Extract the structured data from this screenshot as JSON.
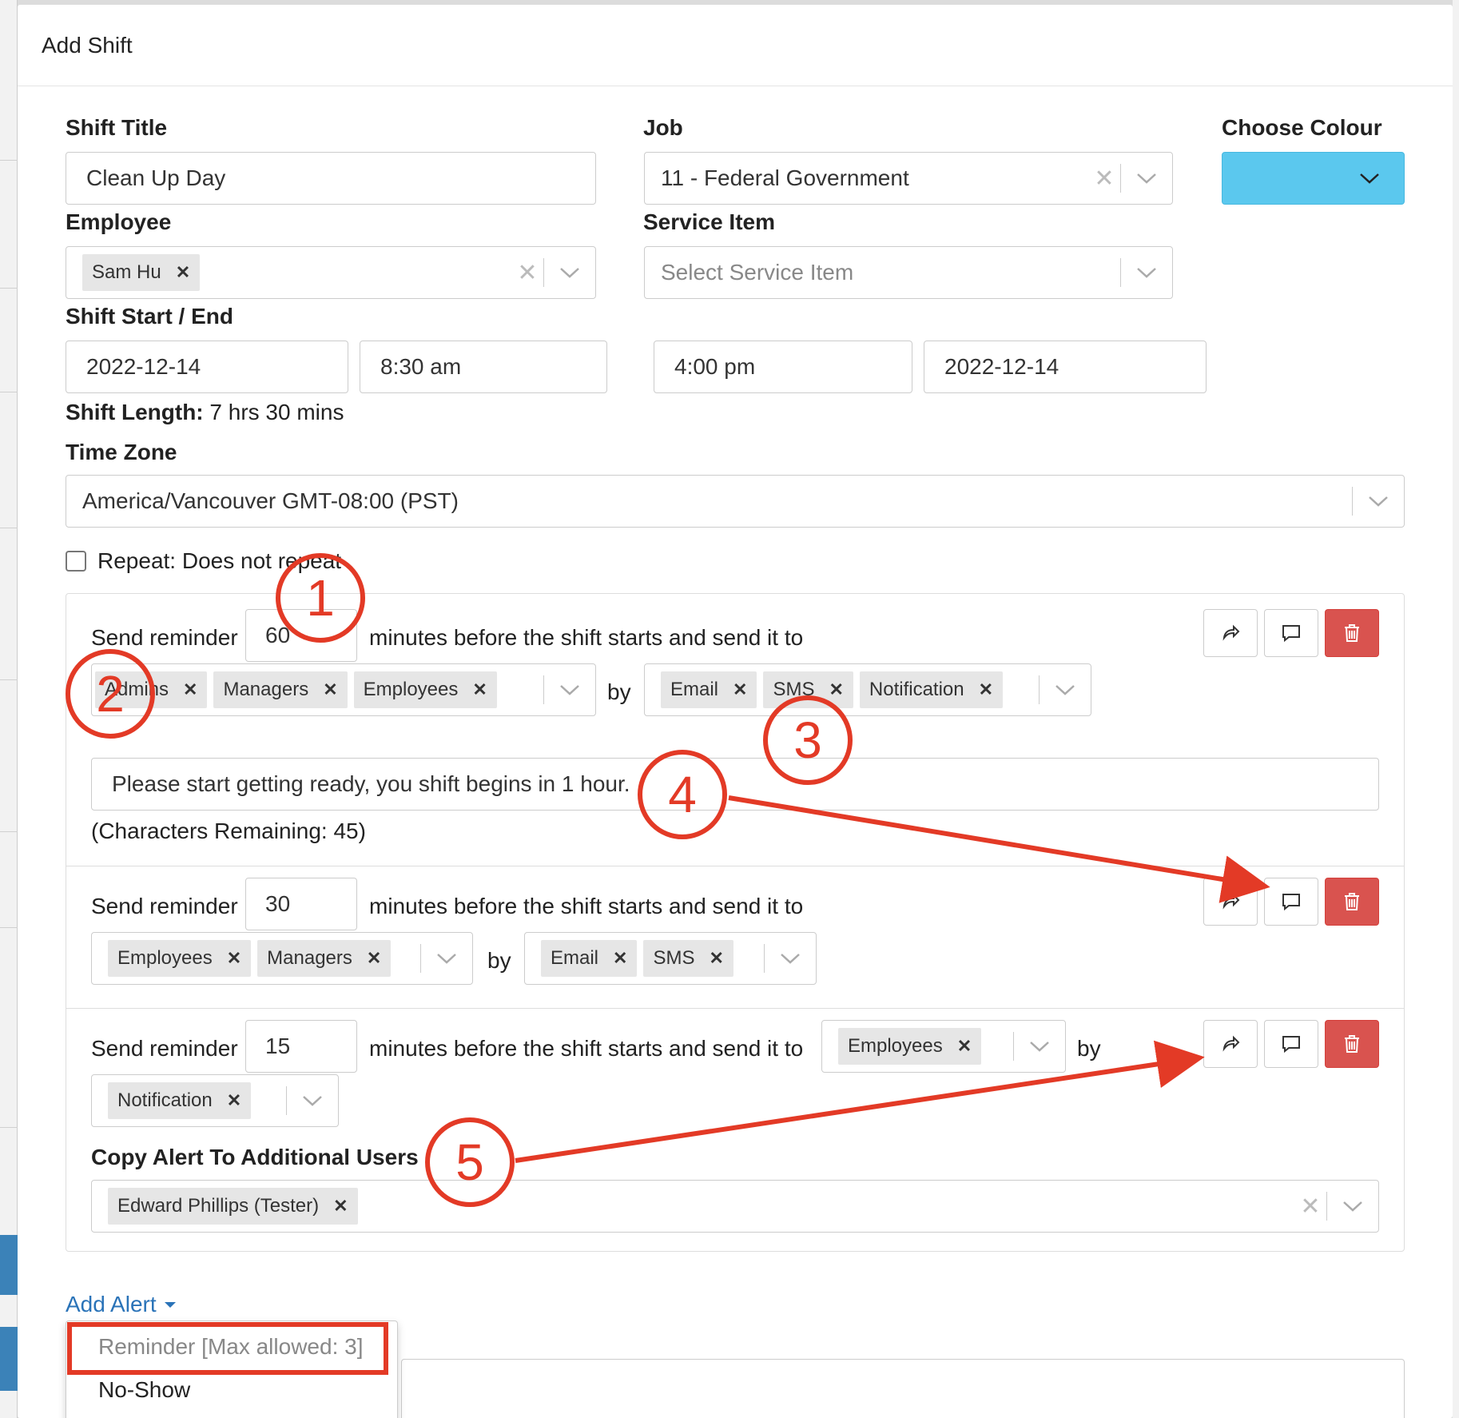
{
  "modal": {
    "title": "Add Shift"
  },
  "form": {
    "shift_title_label": "Shift Title",
    "shift_title_value": "Clean Up Day",
    "job_label": "Job",
    "job_value": "11 - Federal Government",
    "colour_label": "Choose Colour",
    "colour_value": "#5bc8ee",
    "employee_label": "Employee",
    "employee_tags": [
      "Sam Hu"
    ],
    "service_item_label": "Service Item",
    "service_item_placeholder": "Select Service Item",
    "start_end_label": "Shift Start / End",
    "start_date": "2022-12-14",
    "start_time": "8:30 am",
    "end_time": "4:00 pm",
    "end_date": "2022-12-14",
    "shift_length_label": "Shift Length:",
    "shift_length_value": "7 hrs 30 mins",
    "timezone_label": "Time Zone",
    "timezone_value": "America/Vancouver GMT-08:00 (PST)",
    "repeat_label": "Repeat: Does not repeat"
  },
  "reminders": {
    "send_label": "Send reminder",
    "minutes_label": "minutes before the shift starts and send it to",
    "by_label": "by",
    "items": [
      {
        "minutes": "60",
        "recipients": [
          "Admins",
          "Managers",
          "Employees"
        ],
        "channels": [
          "Email",
          "SMS",
          "Notification"
        ],
        "message": "Please start getting ready, you shift begins in 1 hour.",
        "chars_remaining": "(Characters Remaining: 45)"
      },
      {
        "minutes": "30",
        "recipients": [
          "Employees",
          "Managers"
        ],
        "channels": [
          "Email",
          "SMS"
        ]
      },
      {
        "minutes": "15",
        "recipients": [
          "Employees"
        ],
        "channels": [
          "Notification"
        ],
        "copy_label": "Copy Alert To Additional Users",
        "copy_users": [
          "Edward Phillips (Tester)"
        ]
      }
    ]
  },
  "add_alert": {
    "label": "Add Alert",
    "options": [
      "Reminder [Max allowed: 3]",
      "No-Show"
    ]
  },
  "annotations": [
    "1",
    "2",
    "3",
    "4",
    "5"
  ],
  "colors": {
    "accent": "#2a73b8",
    "danger": "#d9534f",
    "annotation": "#e33a26"
  }
}
